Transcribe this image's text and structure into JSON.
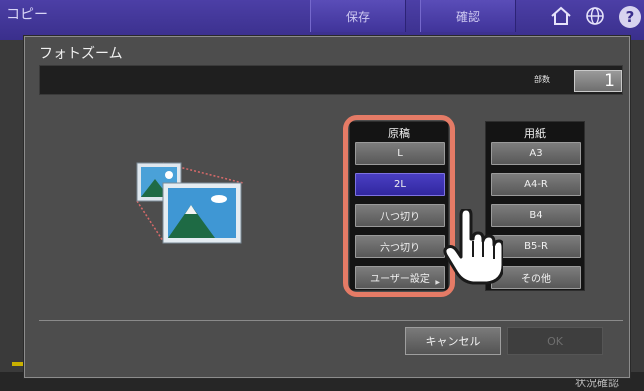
{
  "background": {
    "app_title": "コピー",
    "tabs": [
      "保存",
      "確認"
    ],
    "status_label": "状況確認"
  },
  "dialog": {
    "title": "フォトズーム",
    "copies_label": "部数",
    "copies_value": "1",
    "original": {
      "header": "原稿",
      "options": [
        "L",
        "2L",
        "八つ切り",
        "六つ切り",
        "ユーザー設定"
      ],
      "selected_index": 1
    },
    "paper": {
      "header": "用紙",
      "options": [
        "A3",
        "A4-R",
        "B4",
        "B5-R",
        "その他"
      ]
    },
    "cancel_label": "キャンセル",
    "ok_label": "OK"
  },
  "colors": {
    "selected_blue": "#3a30b0",
    "highlight": "#e57b66",
    "topbar": "#3a2f8c"
  },
  "icons": [
    "home-icon",
    "globe-icon",
    "help-icon",
    "photo-zoom-icon",
    "hand-cursor-icon"
  ]
}
